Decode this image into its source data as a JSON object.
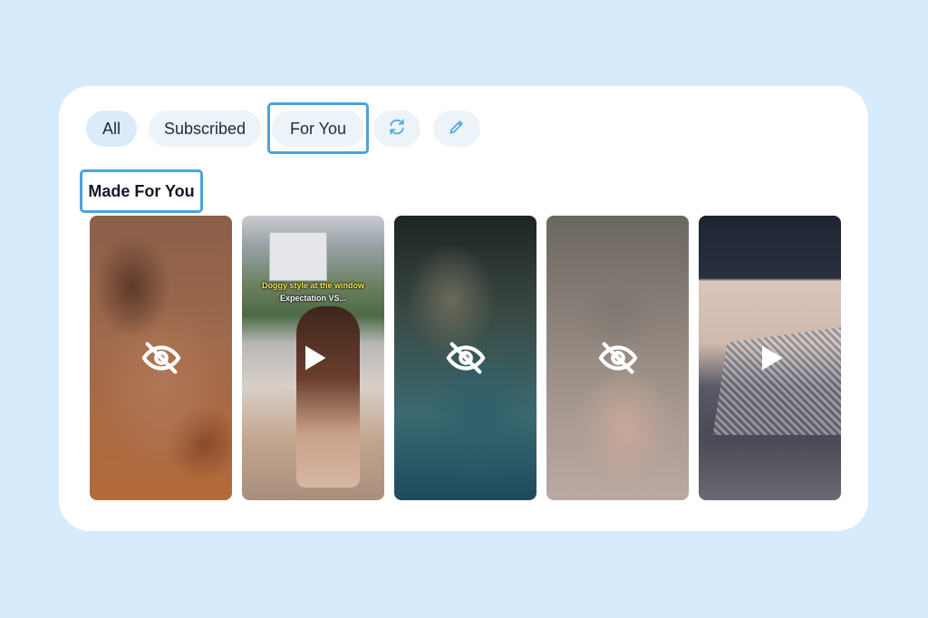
{
  "filters": {
    "all_label": "All",
    "subscribed_label": "Subscribed",
    "for_you_label": "For You"
  },
  "section": {
    "title": "Made For You"
  },
  "thumbnails": [
    {
      "state": "hidden",
      "icon": "eye-off-icon"
    },
    {
      "state": "video",
      "icon": "play-icon",
      "caption_line1": "Doggy style at the window",
      "caption_line2": "Expectation VS..."
    },
    {
      "state": "hidden",
      "icon": "eye-off-icon"
    },
    {
      "state": "hidden",
      "icon": "eye-off-icon"
    },
    {
      "state": "video",
      "icon": "play-icon"
    }
  ],
  "colors": {
    "background": "#d6ebfc",
    "highlight": "#4aa3dd",
    "pill": "#ecf3f9",
    "accent_icon": "#4aa3dd"
  }
}
